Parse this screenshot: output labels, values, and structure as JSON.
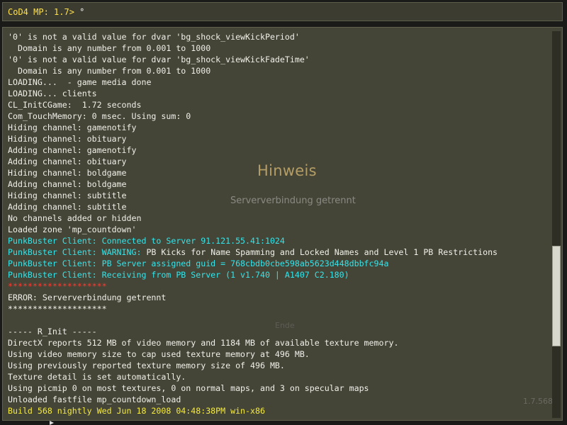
{
  "input": {
    "prompt": "CoD4 MP: 1.7>",
    "typed": " °"
  },
  "log": [
    {
      "text": "'0' is not a valid value for dvar 'bg_shock_viewKickPeriod'",
      "color": "white"
    },
    {
      "text": "  Domain is any number from 0.001 to 1000",
      "color": "white"
    },
    {
      "text": "'0' is not a valid value for dvar 'bg_shock_viewKickFadeTime'",
      "color": "white"
    },
    {
      "text": "  Domain is any number from 0.001 to 1000",
      "color": "white"
    },
    {
      "text": "LOADING...  - game media done",
      "color": "white"
    },
    {
      "text": "LOADING... clients",
      "color": "white"
    },
    {
      "text": "CL_InitCGame:  1.72 seconds",
      "color": "white"
    },
    {
      "text": "Com_TouchMemory: 0 msec. Using sum: 0",
      "color": "white"
    },
    {
      "text": "Hiding channel: gamenotify",
      "color": "white"
    },
    {
      "text": "Hiding channel: obituary",
      "color": "white"
    },
    {
      "text": "Adding channel: gamenotify",
      "color": "white"
    },
    {
      "text": "Adding channel: obituary",
      "color": "white"
    },
    {
      "text": "Hiding channel: boldgame",
      "color": "white"
    },
    {
      "text": "Adding channel: boldgame",
      "color": "white"
    },
    {
      "text": "Hiding channel: subtitle",
      "color": "white"
    },
    {
      "text": "Adding channel: subtitle",
      "color": "white"
    },
    {
      "text": "No channels added or hidden",
      "color": "white"
    },
    {
      "text": "Loaded zone 'mp_countdown'",
      "color": "white"
    },
    {
      "text": "PunkBuster Client: Connected to Server 91.121.55.41:1024",
      "color": "cyan"
    },
    {
      "text": "PunkBuster Client: WARNING:",
      "suffix": " PB Kicks for Name Spamming and Locked Names and Level 1 PB Restrictions",
      "color": "cyan"
    },
    {
      "text": "PunkBuster Client: PB Server assigned guid = 768cbdb0cbe598ab5623d448dbbfc94a",
      "color": "cyan"
    },
    {
      "text": "PunkBuster Client: Receiving from PB Server (1 v1.740 | A1407 C2.180)",
      "color": "cyan"
    },
    {
      "text": "********************",
      "color": "red"
    },
    {
      "text": "ERROR: Serververbindung getrennt",
      "color": "white"
    },
    {
      "text": "********************",
      "color": "white"
    },
    {
      "text": "",
      "color": "white"
    },
    {
      "text": "----- R_Init -----",
      "color": "white"
    },
    {
      "text": "DirectX reports 512 MB of video memory and 1184 MB of available texture memory.",
      "color": "white"
    },
    {
      "text": "Using video memory size to cap used texture memory at 496 MB.",
      "color": "white"
    },
    {
      "text": "Using previously reported texture memory size of 496 MB.",
      "color": "white"
    },
    {
      "text": "Texture detail is set automatically.",
      "color": "white"
    },
    {
      "text": "Using picmip 0 on most textures, 0 on normal maps, and 3 on specular maps",
      "color": "white"
    },
    {
      "text": "Unloaded fastfile mp_countdown_load",
      "color": "white"
    },
    {
      "text": "Build 568 nightly Wed Jun 18 2008 04:48:38PM win-x86",
      "color": "yellow"
    }
  ],
  "overlay": {
    "title": "Hinweis",
    "message": "Serververbindung getrennt",
    "end": "Ende",
    "version": "1.7.568"
  },
  "colors": {
    "prompt": "#ffe04a",
    "cyan": "#34e4ea",
    "red": "#ff3a30",
    "yellow": "#f5ea3c"
  },
  "scrollbar": {
    "position_fraction": 0.75
  }
}
